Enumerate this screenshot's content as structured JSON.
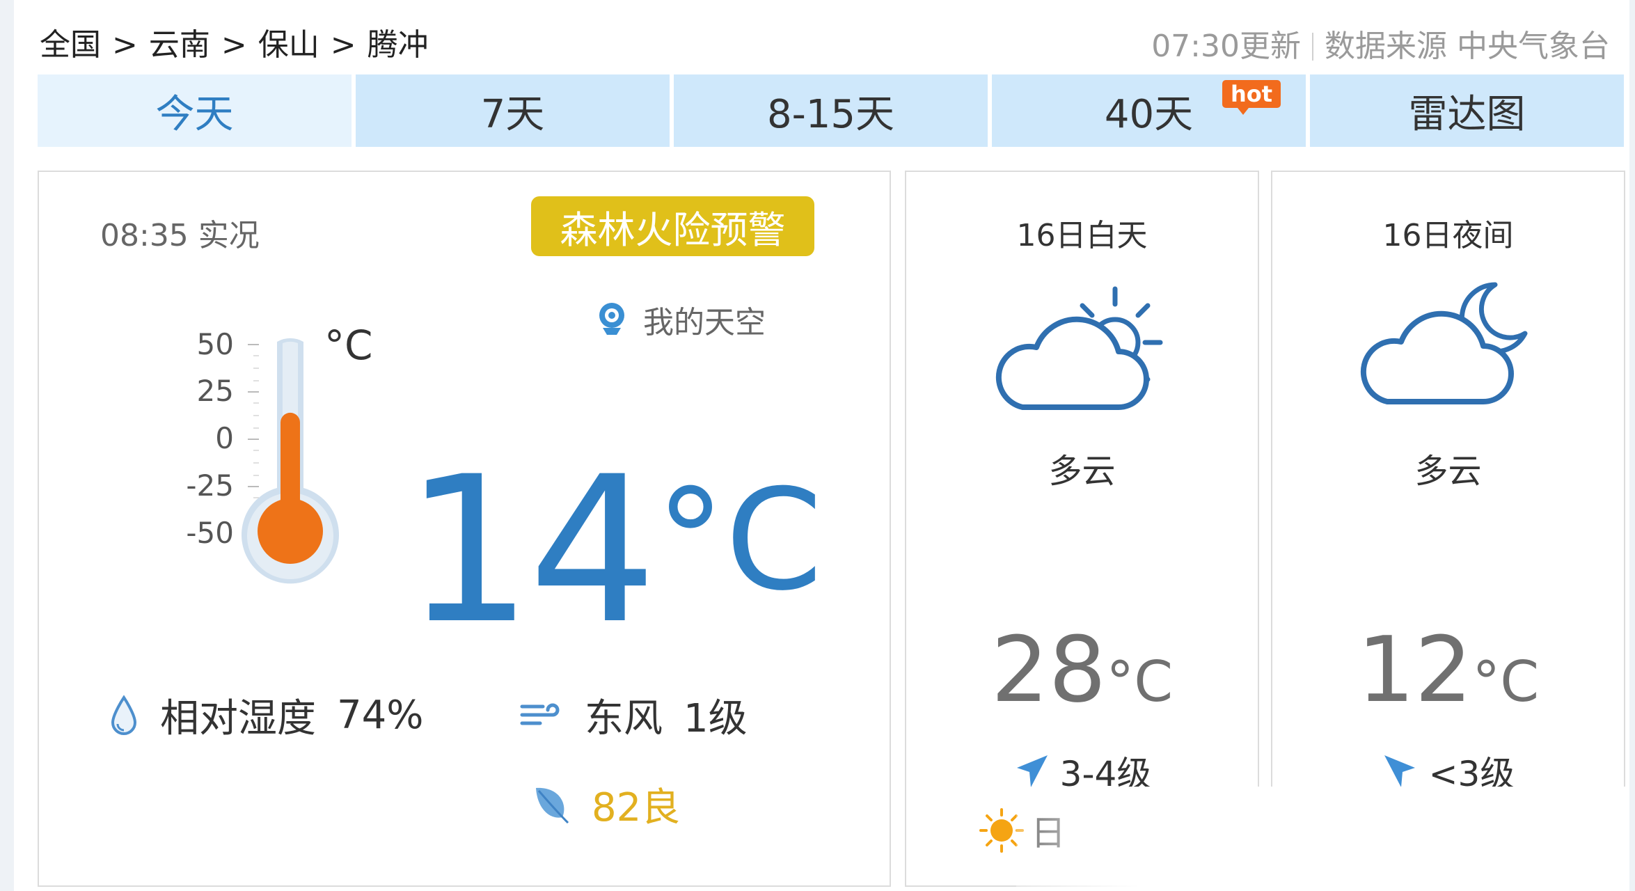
{
  "breadcrumb": {
    "items": [
      "全国",
      "云南",
      "保山",
      "腾冲"
    ],
    "separator": ">"
  },
  "update": {
    "time_text": "07:30更新",
    "source_text": "数据来源 中央气象台"
  },
  "tabs": [
    {
      "label": "今天",
      "active": true
    },
    {
      "label": "7天",
      "active": false
    },
    {
      "label": "8-15天",
      "active": false
    },
    {
      "label": "40天",
      "active": false,
      "badge": "hot"
    },
    {
      "label": "雷达图",
      "active": false
    }
  ],
  "current": {
    "obs_time": "08:35 实况",
    "alert": "森林火险预警",
    "mysky": "我的天空",
    "thermometer": {
      "scale": [
        "50",
        "25",
        "0",
        "-25",
        "-50"
      ],
      "unit": "°C",
      "level_fraction": 0.64
    },
    "temp": "14",
    "temp_unit": "°C",
    "humidity_label": "相对湿度",
    "humidity_value": "74%",
    "wind_dir": "东风",
    "wind_level": "1级",
    "aqi": "82良"
  },
  "forecast": [
    {
      "title": "16日白天",
      "icon": "cloudy-day-icon",
      "desc": "多云",
      "temp": "28",
      "temp_unit": "°C",
      "wind": "3-4级",
      "sun_text": "日"
    },
    {
      "title": "16日夜间",
      "icon": "cloudy-night-icon",
      "desc": "多云",
      "temp": "12",
      "temp_unit": "°C",
      "wind": "<3级"
    }
  ],
  "colors": {
    "accent": "#2f7ec2",
    "tab_bg": "#cfe8fb",
    "tab_active_bg": "#e6f3fd",
    "alert_yellow": "#e0c01a",
    "thermo_orange": "#ee7318",
    "hot_badge": "#f26b1d",
    "aqi": "#e2b020"
  }
}
